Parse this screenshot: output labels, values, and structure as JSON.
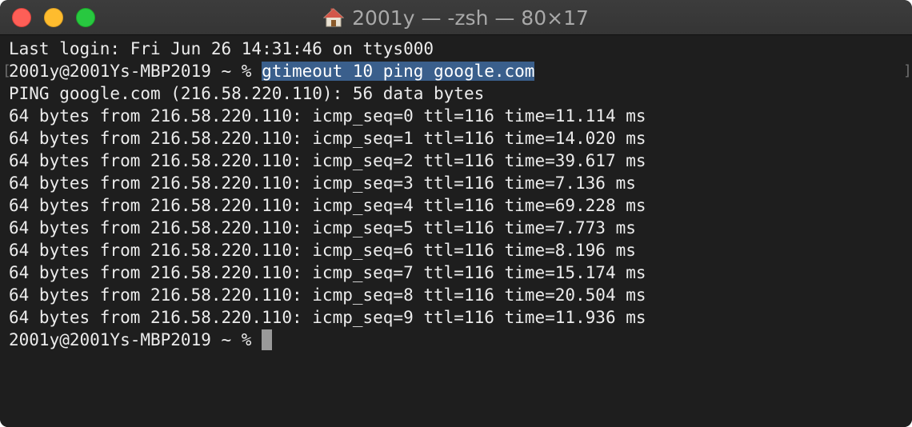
{
  "window": {
    "title": "2001y — -zsh — 80×17"
  },
  "terminal": {
    "last_login": "Last login: Fri Jun 26 14:31:46 on ttys000",
    "prompt": "2001y@2001Ys-MBP2019 ~ % ",
    "command": "gtimeout 10 ping google.com",
    "ping_header": "PING google.com (216.58.220.110): 56 data bytes",
    "replies": [
      "64 bytes from 216.58.220.110: icmp_seq=0 ttl=116 time=11.114 ms",
      "64 bytes from 216.58.220.110: icmp_seq=1 ttl=116 time=14.020 ms",
      "64 bytes from 216.58.220.110: icmp_seq=2 ttl=116 time=39.617 ms",
      "64 bytes from 216.58.220.110: icmp_seq=3 ttl=116 time=7.136 ms",
      "64 bytes from 216.58.220.110: icmp_seq=4 ttl=116 time=69.228 ms",
      "64 bytes from 216.58.220.110: icmp_seq=5 ttl=116 time=7.773 ms",
      "64 bytes from 216.58.220.110: icmp_seq=6 ttl=116 time=8.196 ms",
      "64 bytes from 216.58.220.110: icmp_seq=7 ttl=116 time=15.174 ms",
      "64 bytes from 216.58.220.110: icmp_seq=8 ttl=116 time=20.504 ms",
      "64 bytes from 216.58.220.110: icmp_seq=9 ttl=116 time=11.936 ms"
    ],
    "final_prompt": "2001y@2001Ys-MBP2019 ~ % "
  },
  "icons": {
    "title_icon": "home-folder-icon"
  },
  "colors": {
    "background": "#1e1e1e",
    "text": "#ececec",
    "selection": "#3a5f8c",
    "close": "#fe5f57",
    "minimize": "#febc2e",
    "zoom": "#28c840"
  }
}
